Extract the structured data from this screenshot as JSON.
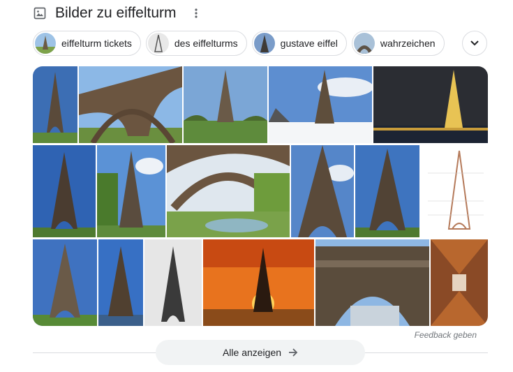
{
  "header": {
    "title": "Bilder zu eiffelturm",
    "image_icon": "image-icon",
    "more_icon": "more-vert-icon"
  },
  "chips": [
    {
      "label": "eiffelturm tickets"
    },
    {
      "label": "des eiffelturms"
    },
    {
      "label": "gustave eiffel"
    },
    {
      "label": "wahrzeichen"
    }
  ],
  "expand_icon": "chevron-down-icon",
  "footer": {
    "feedback": "Feedback geben",
    "show_all": "Alle anzeigen",
    "arrow_icon": "arrow-right-icon"
  },
  "colors": {
    "text": "#202124",
    "border": "#dadce0",
    "muted": "#70757a",
    "button_bg": "#f1f3f4"
  }
}
